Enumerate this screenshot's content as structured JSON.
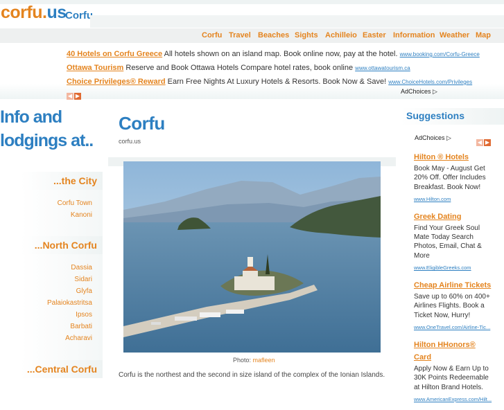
{
  "header": {
    "logo_main": "corfu.",
    "logo_us": "us",
    "logo_sub": "Corfu"
  },
  "nav": [
    "Corfu",
    "Travel",
    "Beaches",
    "Sights",
    "Achilleio",
    "Easter",
    "Information",
    "Weather",
    "Map"
  ],
  "top_ads": [
    {
      "title": "40 Hotels on Corfu Greece",
      "text": "All hotels shown on an island map. Book online now, pay at the hotel.",
      "url": "www.booking.com/Corfu-Greece"
    },
    {
      "title": "Ottawa Tourism",
      "text": "Reserve and Book Ottawa Hotels Compare hotel rates, book online",
      "url": "www.ottawatourism.ca"
    },
    {
      "title": "Choice Privileges® Reward",
      "text": "Earn Free Nights At Luxury Hotels & Resorts. Book Now & Save!",
      "url": "www.ChoiceHotels.com/Privileges"
    }
  ],
  "adchoices_label": "AdChoices",
  "left": {
    "title_line1": "Info and",
    "title_line2": "lodgings at..",
    "sections": [
      {
        "heading": "...the City",
        "links": [
          "Corfu Town",
          "Kanoni"
        ]
      },
      {
        "heading": "...North Corfu",
        "links": [
          "Dassia",
          "Sidari",
          "Glyfa",
          "Palaiokastritsa",
          "Ipsos",
          "Barbati",
          "Acharavi"
        ]
      },
      {
        "heading": "...Central Corfu",
        "links": []
      }
    ]
  },
  "main": {
    "title": "Corfu",
    "subtitle": "corfu.us",
    "caption_prefix": "Photo:",
    "caption_credit": "mafleen",
    "body": "Corfu is the northest and the second in size island of the complex of the Ionian Islands."
  },
  "right": {
    "title": "Suggestions",
    "ads": [
      {
        "title": "Hilton ® Hotels",
        "text": "Book May - August Get 20% Off. Offer Includes Breakfast. Book Now!",
        "url": "www.Hilton.com"
      },
      {
        "title": "Greek Dating",
        "text": "Find Your Greek Soul Mate Today Search Photos, Email, Chat & More",
        "url": "www.EligibleGreeks.com"
      },
      {
        "title": "Cheap Airline Tickets",
        "text": "Save up to 60% on 400+ Airlines Flights. Book a Ticket Now, Hurry!",
        "url": "www.OneTravel.com/Airline-Tic..."
      },
      {
        "title": "Hilton HHonors® Card",
        "text": "Apply Now & Earn Up to 30K Points Redeemable at Hilton Brand Hotels.",
        "url": "www.AmericanExpress.com/Hilt..."
      }
    ]
  },
  "colors": {
    "accent": "#e4841f",
    "brand": "#2d7fc1"
  }
}
